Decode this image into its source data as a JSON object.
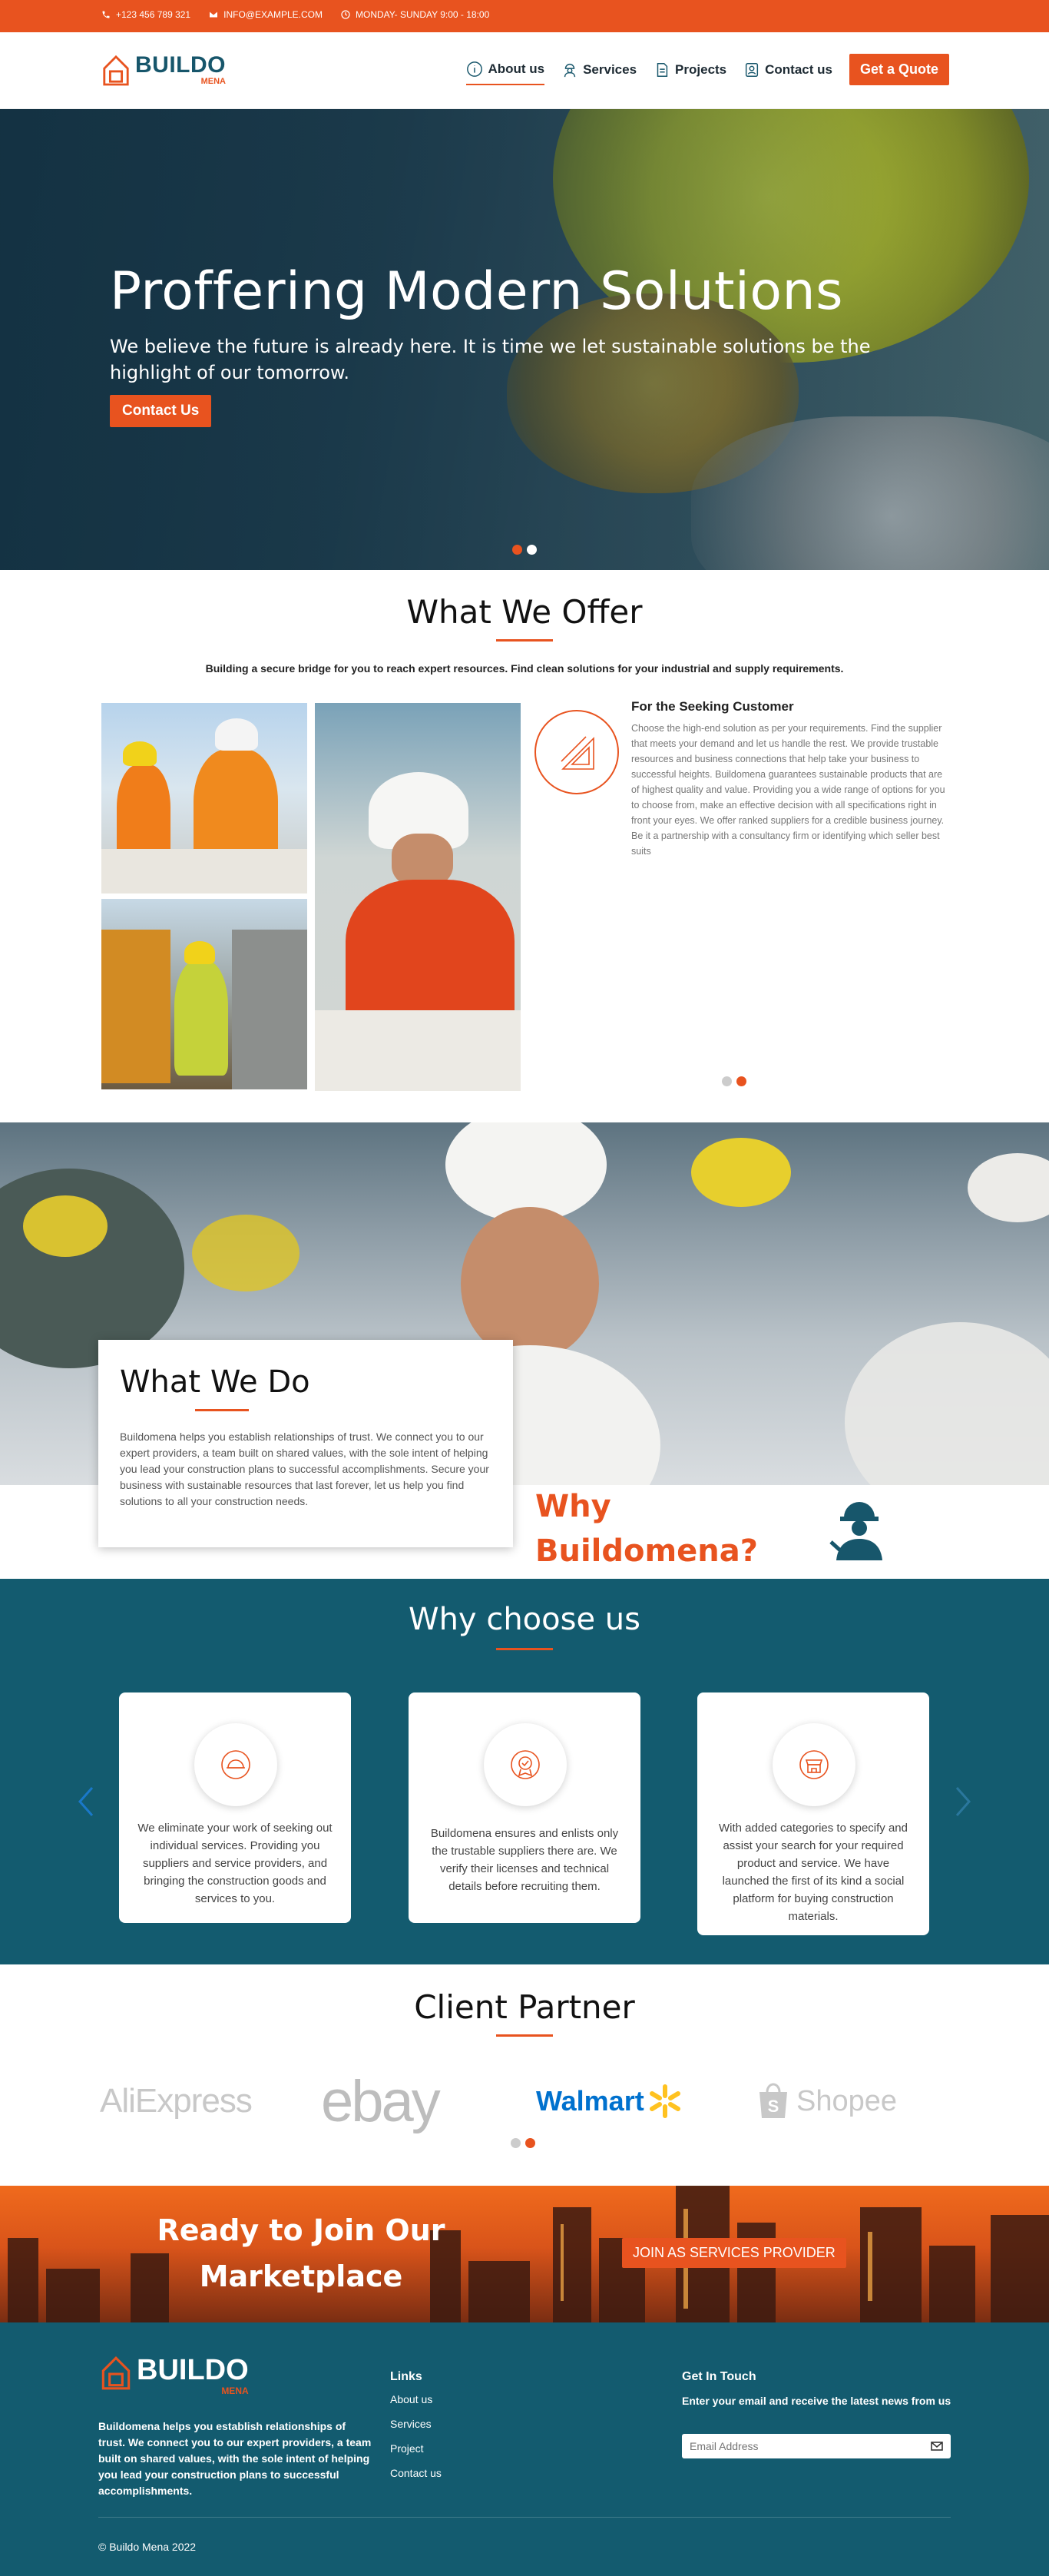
{
  "topbar": {
    "phone": "+123 456 789 321",
    "email": "INFO@EXAMPLE.COM",
    "hours": "MONDAY- SUNDAY 9:00 - 18:00"
  },
  "brand": {
    "name": "BUILDO",
    "sub": "MENA"
  },
  "nav": {
    "items": [
      {
        "label": "About us",
        "icon": "info-icon",
        "active": true
      },
      {
        "label": "Services",
        "icon": "worker-icon"
      },
      {
        "label": "Projects",
        "icon": "document-icon"
      },
      {
        "label": "Contact us",
        "icon": "contact-card-icon"
      }
    ],
    "quote_label": "Get a Quote"
  },
  "hero": {
    "title": "Proffering Modern Solutions",
    "subtitle": "We believe the future is already here. It is time we let sustainable solutions be the highlight of our tomorrow.",
    "cta_label": "Contact Us",
    "slides": 2,
    "active_slide": 0
  },
  "offer": {
    "title": "What We Offer",
    "subtitle": "Building a secure bridge for you to reach expert resources. Find clean solutions for your industrial and supply requirements.",
    "card_title": "For the Seeking Customer",
    "card_text": "Choose the high-end solution as per your requirements. Find the supplier that meets your demand and let us handle the rest. We provide trustable resources and business connections that help take your business to successful heights. Buildomena guarantees sustainable products that are of highest quality and value. Providing you a wide range of options for you to choose from, make an effective decision with all specifications right in front your eyes. We offer ranked suppliers for a credible business journey. Be it a partnership with a consultancy firm or identifying which seller best suits",
    "active_slide": 1
  },
  "whatdo": {
    "title": "What We Do",
    "text": "Buildomena helps you establish relationships of trust. We connect you to our expert providers, a team built on shared values, with the sole intent of helping you lead your construction plans to successful accomplishments. Secure your business with sustainable resources that last forever, let us help you find solutions to all your construction needs.",
    "why_line1": "Why",
    "why_line2": "Buildomena?"
  },
  "why": {
    "title": "Why choose us",
    "cards": [
      {
        "icon": "helmet-icon",
        "text": "We eliminate your work of seeking out individual services. Providing you suppliers and service providers, and bringing the construction goods and services to you."
      },
      {
        "icon": "verified-badge-icon",
        "text": "Buildomena ensures and enlists only the trustable suppliers there are. We verify their licenses and technical details before recruiting them."
      },
      {
        "icon": "store-icon",
        "text": "With added categories to specify and assist your search for your required product and service. We have launched the first of its kind a social platform for buying construction materials."
      }
    ]
  },
  "partners": {
    "title": "Client Partner",
    "brands": [
      "AliExpress",
      "ebay",
      "Walmart",
      "Shopee"
    ],
    "active_slide": 1
  },
  "cta": {
    "title": "Ready to Join Our Marketplace",
    "button": "JOIN AS SERVICES PROVIDER"
  },
  "footer": {
    "about": "Buildomena helps you establish relationships of trust. We connect you to our expert providers, a team built on shared values, with the sole intent of helping you lead your construction plans to successful accomplishments.",
    "links_title": "Links",
    "links": [
      "About us",
      "Services",
      "Project",
      "Contact us"
    ],
    "contact_title": "Get In Touch",
    "contact_text": "Enter your email and receive the latest news from us",
    "email_placeholder": "Email Address",
    "copyright": "© Buildo Mena 2022"
  },
  "colors": {
    "accent": "#e8531f",
    "teal": "#135b6f"
  }
}
